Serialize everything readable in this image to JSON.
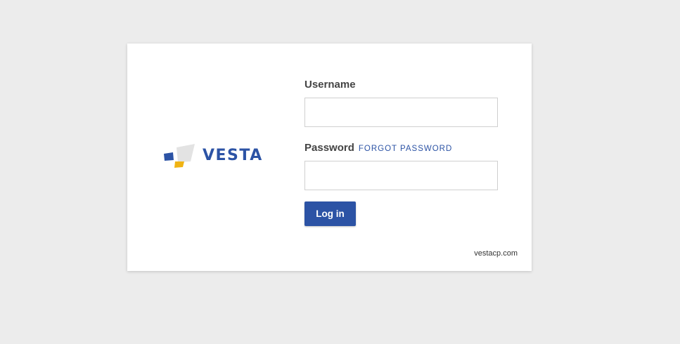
{
  "logo": {
    "text": "VESTA",
    "icon": "vesta-logo-icon",
    "colors": {
      "blue": "#2c53a5",
      "yellow": "#f0b313",
      "gray": "#e3e3e3"
    }
  },
  "login_form": {
    "username_label": "Username",
    "username_value": "",
    "password_label": "Password",
    "password_value": "",
    "forgot_password_label": "FORGOT PASSWORD",
    "login_button_label": "Log in"
  },
  "footer": {
    "link_text": "vestacp.com"
  },
  "colors": {
    "background": "#ececec",
    "card": "#ffffff",
    "accent": "#2c53a5",
    "label_text": "#444444"
  }
}
